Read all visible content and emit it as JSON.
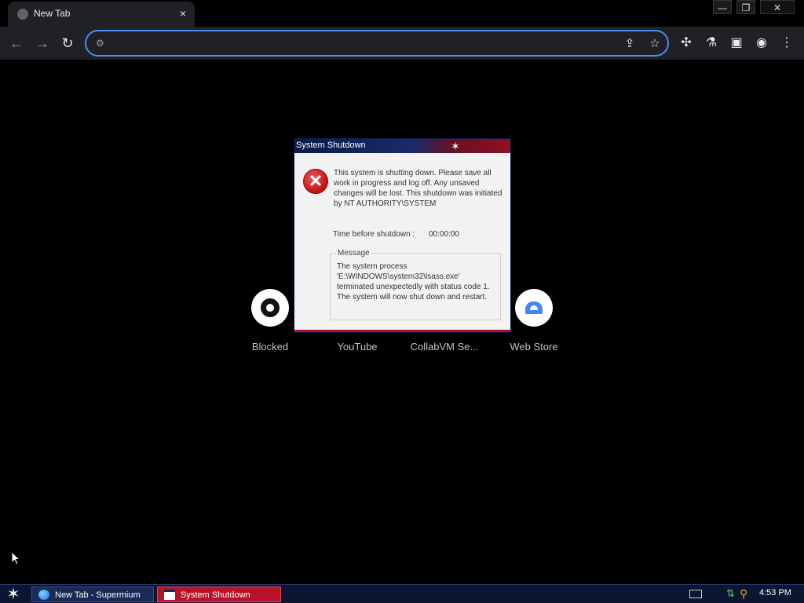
{
  "browser": {
    "tab": {
      "title": "New Tab",
      "close": "×"
    },
    "window_controls": {
      "minimize": "—",
      "restore": "❐",
      "close": "✕"
    },
    "omnibox": {
      "value": "",
      "placeholder": ""
    },
    "nav": {
      "back": "←",
      "forward": "→",
      "reload": "↻"
    }
  },
  "shortcuts": [
    {
      "label": "Blocked",
      "icon": "github-icon"
    },
    {
      "label": "YouTube",
      "icon": "youtube-icon"
    },
    {
      "label": "CollabVM Se...",
      "icon": "collabvm-icon"
    },
    {
      "label": "Web Store",
      "icon": "web-store-icon"
    }
  ],
  "dialog": {
    "title": "System Shutdown",
    "message": "This system is shutting down. Please save all work in progress and log off. Any unsaved changes will be lost. This shutdown was initiated by NT AUTHORITY\\SYSTEM",
    "time_label": "Time before shutdown :",
    "time_value": "00:00:00",
    "group_label": "Message",
    "group_text": "The system process 'E:\\WINDOWS\\system32\\lsass.exe' terminated unexpectedly with status code 1. The system will now shut down and restart."
  },
  "taskbar": {
    "tasks": [
      {
        "label": "New Tab - Supermium"
      },
      {
        "label": "System Shutdown"
      }
    ],
    "clock": "4:53 PM"
  },
  "colors": {
    "omnibox_border": "#4c8bf5",
    "dialog_title_start": "#0b1a4a",
    "dialog_title_end": "#8e1124",
    "taskbar_bg": "#0b1633",
    "active_task": "#b8122a"
  }
}
